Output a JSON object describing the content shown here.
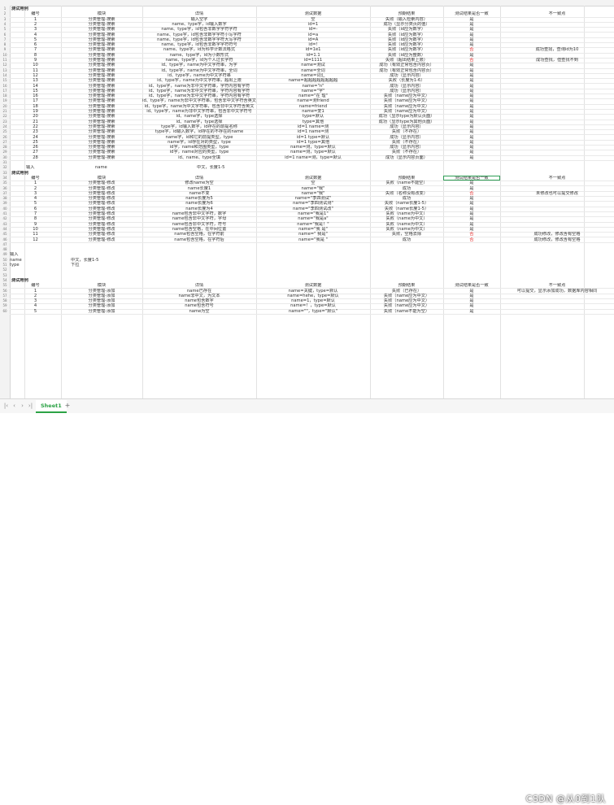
{
  "section1": {
    "title": "测试用例",
    "headers": [
      "编号",
      "模块",
      "详情",
      "测试数据",
      "预期结果",
      "测试结果是否一致",
      "不一致点"
    ],
    "rows": [
      {
        "n": "1",
        "m": "分类管理-搜索",
        "d": "输入空字",
        "t": "空",
        "e": "失败（输入检索内容）",
        "r": "是",
        "x": ""
      },
      {
        "n": "2",
        "m": "分类管理-搜索",
        "d": "name、type字，id输入数字",
        "t": "id=1",
        "e": "成功（显示分类页的值）",
        "r": "是",
        "x": ""
      },
      {
        "n": "3",
        "m": "分类管理-搜索",
        "d": "name、type字，id包含非数字字符字符",
        "t": "id=-",
        "e": "失败（id应为数字）",
        "r": "是",
        "x": ""
      },
      {
        "n": "4",
        "m": "分类管理-搜索",
        "d": "name、type字，id包含非数字字符小写字符",
        "t": "id=a",
        "e": "失败（id应为数字）",
        "r": "是",
        "x": ""
      },
      {
        "n": "5",
        "m": "分类管理-搜索",
        "d": "name、type字，id包含非数字字符大写字符",
        "t": "id=A",
        "e": "失败（id应为数字）",
        "r": "是",
        "x": ""
      },
      {
        "n": "6",
        "m": "分类管理-搜索",
        "d": "name、type字，id包含非数字字符符号",
        "t": "id=!",
        "e": "失败（id应为数字）",
        "r": "是",
        "x": ""
      },
      {
        "n": "7",
        "m": "分类管理-搜索",
        "d": "name、type字，id为科学计数法格式",
        "t": "id=1e1",
        "e": "失败（id应为数字）",
        "r": "否",
        "x": "成功查找，查询id为10"
      },
      {
        "n": "8",
        "m": "分类管理-搜索",
        "d": "name、type字，id为小数形式",
        "t": "id=1.1",
        "e": "失败（id应为整数）",
        "r": "是",
        "x": ""
      },
      {
        "n": "9",
        "m": "分类管理-搜索",
        "d": "name、type字，id为个人过长字符",
        "t": "id=1111",
        "e": "失败（超出结果上限）",
        "r": "否",
        "x": "成功查找，但查找不到"
      },
      {
        "n": "10",
        "m": "分类管理-搜索",
        "d": "id、type字，name为中文字符串，为字",
        "t": "name=测试",
        "e": "成功（有效正常包含内容页）",
        "r": "是",
        "x": ""
      },
      {
        "n": "11",
        "m": "分类管理-搜索",
        "d": "id、type字，name为中文字符串，全词",
        "t": "name=全词",
        "e": "成功（有效正常包含内容页）",
        "r": "是",
        "x": ""
      },
      {
        "n": "12",
        "m": "分类管理-搜索",
        "d": "id、type字，name为中文字符串",
        "t": "name=词汇",
        "e": "成功（显示内容）",
        "r": "是",
        "x": ""
      },
      {
        "n": "13",
        "m": "分类管理-搜索",
        "d": "id、type字，name为中文字符串，超出上限",
        "t": "name=超超超超超超超超",
        "e": "失败（长度为1-6）",
        "r": "是",
        "x": ""
      },
      {
        "n": "14",
        "m": "分类管理-搜索",
        "d": "id、type字，name为非中文字符串，字符内容有字符",
        "t": "name=\"n\"",
        "e": "成功（显示内容）",
        "r": "是",
        "x": ""
      },
      {
        "n": "15",
        "m": "分类管理-搜索",
        "d": "id、type字，name为非中文字符串，字符内容有字符",
        "t": "name=\"字\"",
        "e": "成功（显示内容）",
        "r": "是",
        "x": ""
      },
      {
        "n": "16",
        "m": "分类管理-搜索",
        "d": "id、type字，name为非中文字符串，字符内容有字符",
        "t": "name=\"在 理\"",
        "e": "失败（name应为中文）",
        "r": "是",
        "x": ""
      },
      {
        "n": "17",
        "m": "分类管理-搜索",
        "d": "id、type字，name为非中文字符串，包含非中文字符含英文",
        "t": "name=测friend",
        "e": "失败（name应为中文）",
        "r": "是",
        "x": ""
      },
      {
        "n": "18",
        "m": "分类管理-搜索",
        "d": "id、type字，name为中文字符串，包含非中文字符含英文",
        "t": "name=friend",
        "e": "失败（name应为中文）",
        "r": "是",
        "x": ""
      },
      {
        "n": "19",
        "m": "分类管理-搜索",
        "d": "id、type字，name为非中文字符串，包含非中文字符号",
        "t": "name=爱1",
        "e": "失败（name应为中文）",
        "r": "是",
        "x": ""
      },
      {
        "n": "20",
        "m": "分类管理-搜索",
        "d": "id、name字，type选择",
        "t": "type=默认",
        "e": "成功（显示type为默认页面）",
        "r": "是",
        "x": ""
      },
      {
        "n": "21",
        "m": "分类管理-搜索",
        "d": "id、name字，type选择",
        "t": "type=其他",
        "e": "成功（显示type为其他页面）",
        "r": "是",
        "x": ""
      },
      {
        "n": "22",
        "m": "分类管理-搜索",
        "d": "type字，id输入数字，id存在的前提名称",
        "t": "id=1 name=测",
        "e": "成功（显示内容）",
        "r": "是",
        "x": ""
      },
      {
        "n": "23",
        "m": "分类管理-搜索",
        "d": "type字，id输入数字，id存在的不存在的name",
        "t": "id=1 name=测",
        "e": "失败（不存在）",
        "r": "是",
        "x": ""
      },
      {
        "n": "24",
        "m": "分类管理-搜索",
        "d": "name字，id和它的前提类型，type",
        "t": "id=1 type=默认",
        "e": "成功（显示内容）",
        "r": "是",
        "x": ""
      },
      {
        "n": "25",
        "m": "分类管理-搜索",
        "d": "name字，id存在对的类型，type",
        "t": "id=1 type=其他",
        "e": "失败（不存在）",
        "r": "是",
        "x": ""
      },
      {
        "n": "26",
        "m": "分类管理-搜索",
        "d": "id字，name和范围类型，type",
        "t": "name=测，type=默认",
        "e": "成功（显示内容）",
        "r": "是",
        "x": ""
      },
      {
        "n": "27",
        "m": "分类管理-搜索",
        "d": "id字，name对应的类型，type",
        "t": "name=测，type=默认",
        "e": "失败（不存在）",
        "r": "是",
        "x": ""
      },
      {
        "n": "28",
        "m": "分类管理-搜索",
        "d": "id、name、type全填",
        "t": "id=1 name=测，type=默认",
        "e": "成功（显示内容页面）",
        "r": "是",
        "x": ""
      }
    ]
  },
  "input1": {
    "label": "输入",
    "field": "name",
    "value": "中文，长度1-5"
  },
  "section2": {
    "title": "测试用例",
    "headers": [
      "编号",
      "模块",
      "详情",
      "测试数据",
      "预期结果",
      "测试结果是否一致",
      "不一致点"
    ],
    "rows": [
      {
        "n": "1",
        "m": "分类管理-修改",
        "d": "修改name为空",
        "t": "空",
        "e": "失败（name不能空）",
        "r": "是",
        "x": ""
      },
      {
        "n": "2",
        "m": "分类管理-修改",
        "d": "name长度1",
        "t": "name=\"我\"",
        "e": "成功",
        "r": "是",
        "x": ""
      },
      {
        "n": "3",
        "m": "分类管理-修改",
        "d": "name不变",
        "t": "name=\"我\"",
        "e": "失败（名称没有改变）",
        "r": "否",
        "x": "未修改也可以提交修改"
      },
      {
        "n": "4",
        "m": "分类管理-修改",
        "d": "name长度为5",
        "t": "name=\"李四测试\"",
        "e": "成功",
        "r": "是",
        "x": ""
      },
      {
        "n": "5",
        "m": "分类管理-修改",
        "d": "name长度为6",
        "t": "name=\"李四测试测\"",
        "e": "失败（name长度1-5）",
        "r": "是",
        "x": ""
      },
      {
        "n": "6",
        "m": "分类管理-修改",
        "d": "name长度为4",
        "t": "name=\"李四测试改\"",
        "e": "失败（name长度1-5）",
        "r": "是",
        "x": ""
      },
      {
        "n": "7",
        "m": "分类管理-修改",
        "d": "name包含非中文字符，数字",
        "t": "name=\"我是1\"",
        "e": "失败（name为中文）",
        "r": "是",
        "x": ""
      },
      {
        "n": "8",
        "m": "分类管理-修改",
        "d": "name包含非中文字符，字母",
        "t": "name=\"我是a\"",
        "e": "失败（name为中文）",
        "r": "是",
        "x": ""
      },
      {
        "n": "9",
        "m": "分类管理-修改",
        "d": "name包含非中文字符，符号",
        "t": "name=\"我是！\"",
        "e": "失败（name为中文）",
        "r": "是",
        "x": ""
      },
      {
        "n": "10",
        "m": "分类管理-修改",
        "d": "name包含空格，在中间位置",
        "t": "name=\"我 是\"",
        "e": "失败（name为中文）",
        "r": "是",
        "x": ""
      },
      {
        "n": "11",
        "m": "分类管理-修改",
        "d": "name包含空格，在字符前",
        "t": "name=\" 我是\"",
        "e": "失败，空格去除",
        "r": "否",
        "x": "成功修改，修改含有空格"
      },
      {
        "n": "12",
        "m": "分类管理-修改",
        "d": "name包含空格，在字符后",
        "t": "name=\"我是 \"",
        "e": "成功",
        "r": "否",
        "x": "成功修改，修改含有空格"
      }
    ]
  },
  "input2": {
    "label": "输入",
    "rows": [
      {
        "field": "name",
        "value": "中文，长度1-5"
      },
      {
        "field": "type",
        "value": "下拉"
      }
    ]
  },
  "section3": {
    "title": "测试用例",
    "headers": [
      "编号",
      "模块",
      "详情",
      "测试数据",
      "预期结果",
      "测试结果是否一致",
      "不一致点"
    ],
    "rows": [
      {
        "n": "1",
        "m": "分类管理-添加",
        "d": "name已存在",
        "t": "name=关键，type=默认",
        "e": "失败（已存在）",
        "r": "是",
        "x": "可以提交，显示添加成功，数据库内容相同"
      },
      {
        "n": "2",
        "m": "分类管理-添加",
        "d": "name非中文，为文本",
        "t": "name=hehe，type=默认",
        "e": "失败（name应为中文）",
        "r": "是",
        "x": ""
      },
      {
        "n": "3",
        "m": "分类管理-添加",
        "d": "name包含数字",
        "t": "name=1，type=默认",
        "e": "失败（name应为中文）",
        "r": "是",
        "x": ""
      },
      {
        "n": "4",
        "m": "分类管理-添加",
        "d": "name包含符号",
        "t": "name=！，type=默认",
        "e": "失败（name应为中文）",
        "r": "是",
        "x": ""
      },
      {
        "n": "5",
        "m": "分类管理-添加",
        "d": "name为空",
        "t": "name=\"\"，type=\"默认\"",
        "e": "失败（name不能为空）",
        "r": "是",
        "x": ""
      }
    ]
  },
  "tabbar": {
    "sheet_name": "Sheet1",
    "add_label": "+"
  },
  "watermark": "CSDN @从0到1队"
}
